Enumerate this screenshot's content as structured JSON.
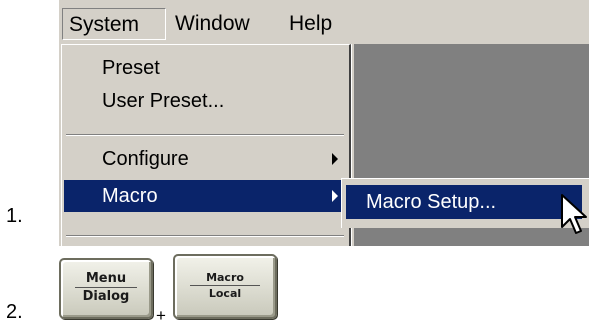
{
  "steps": {
    "step1": "1.",
    "step2": "2."
  },
  "menubar": {
    "items": [
      "System",
      "Window",
      "Help"
    ],
    "open_menu": "System"
  },
  "system_menu": {
    "items": [
      {
        "label": "Preset",
        "has_submenu": false
      },
      {
        "label": "User Preset...",
        "has_submenu": false
      },
      {
        "label": "Configure",
        "has_submenu": true
      },
      {
        "label": "Macro",
        "has_submenu": true,
        "selected": true
      }
    ]
  },
  "submenu": {
    "items": [
      {
        "label": "Macro Setup...",
        "selected": true
      }
    ]
  },
  "keys": {
    "menu_dialog": {
      "line1": "Menu",
      "line2": "Dialog"
    },
    "plus": "+",
    "macro_local": {
      "line1": "Macro",
      "line2": "Local"
    }
  },
  "colors": {
    "menu_bg": "#d4d0c8",
    "highlight": "#0a246a",
    "workspace": "#808080"
  }
}
